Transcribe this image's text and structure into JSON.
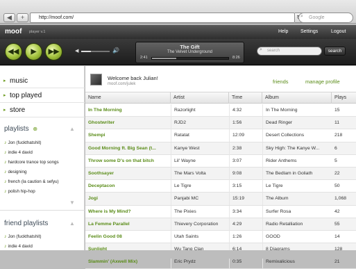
{
  "browser": {
    "back": "◀",
    "add": "+",
    "url": "http://moof.com/",
    "reload": "↻",
    "search_placeholder": "Google"
  },
  "app": {
    "logo": "moof",
    "version": "player v.1",
    "nav": [
      "Help",
      "Settings",
      "Logout"
    ]
  },
  "player": {
    "track_title": "The Gift",
    "track_artist": "The Velvet Underground",
    "elapsed": "2:41",
    "total": "8:26",
    "progress": 0.32,
    "volume": 0.35,
    "search_placeholder": "search",
    "search_button": "search"
  },
  "sidebar": {
    "nav": [
      "music",
      "top played",
      "store"
    ],
    "playlists_title": "playlists",
    "playlists": [
      "Jon (fuckthatshit)",
      "indie 4 david",
      "hardcore trance top songs",
      "designing",
      "french (la caution & sefyu)",
      "polish hip-hop"
    ],
    "friend_playlists_title": "friend playlists",
    "friend_playlists": [
      "Jon (fuckthatshit)",
      "indie 4 david"
    ]
  },
  "welcome": {
    "greeting": "Welcome back Julian!",
    "profile_url": "moof.com/julek",
    "friends": "friends",
    "manage_profile": "manage profile"
  },
  "table": {
    "headers": [
      "Name",
      "Artist",
      "Time",
      "Album",
      "Plays"
    ],
    "rows": [
      [
        "In The Morning",
        "Razorlight",
        "4:32",
        "In The Morning",
        "15"
      ],
      [
        "Ghostwriter",
        "RJD2",
        "1:56",
        "Dead Ringer",
        "11"
      ],
      [
        "Shempi",
        "Ratatat",
        "12:09",
        "Desert Collections",
        "218"
      ],
      [
        "Good Morning ft. Big Sean (t...",
        "Kanye West",
        "2:38",
        "Sky High: The Kanye W...",
        "6"
      ],
      [
        "Throw some D's on that bitch",
        "Lil' Wayne",
        "3:07",
        "Rider Anthems",
        "5"
      ],
      [
        "Soothsayer",
        "The Mars Volta",
        "9:08",
        "The Bedlam in Goliath",
        "22"
      ],
      [
        "Deceptacon",
        "Le Tigre",
        "3:15",
        "Le Tigre",
        "50"
      ],
      [
        "Jogi",
        "Panjabi MC",
        "15:19",
        "The Album",
        "1,068"
      ],
      [
        "Where is My Mind?",
        "The Pixies",
        "3:34",
        "Surfer Rosa",
        "42"
      ],
      [
        "La Femme Parallel",
        "Thievery Corporation",
        "4:29",
        "Radio Retalliation",
        "55"
      ],
      [
        "Feelin Good 08",
        "Utah Saints",
        "1:26",
        "GOOD",
        "14"
      ],
      [
        "Sunlight",
        "Wu Tang Clan",
        "6:14",
        "8 Diagrams",
        "128"
      ],
      [
        "Slammin' (Axwell Mix)",
        "Eric Prydz",
        "0:35",
        "Remixalicious",
        "21"
      ]
    ]
  },
  "colors": {
    "accent": "#5a8c18",
    "header_dark": "#2e2e2e"
  }
}
